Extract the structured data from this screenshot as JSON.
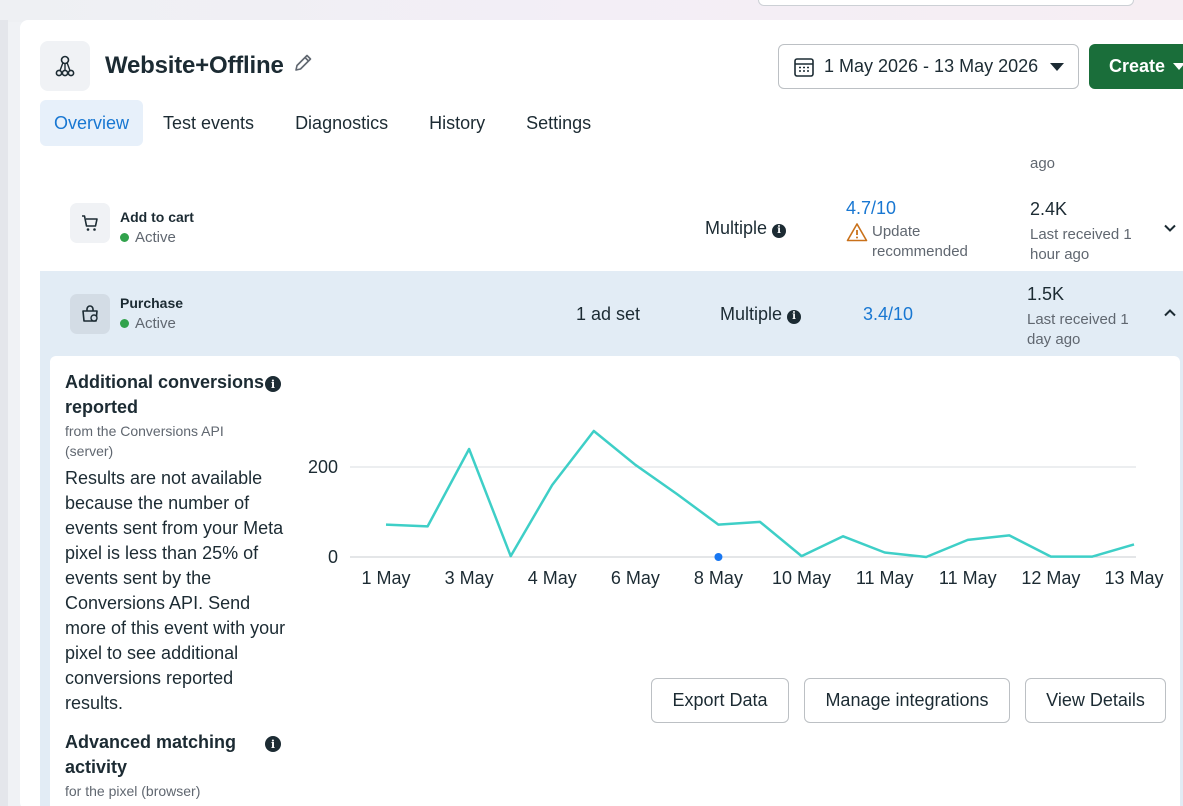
{
  "header": {
    "title": "Website+Offline",
    "date_range": "1 May 2026 - 13 May 2026",
    "create_label": "Create"
  },
  "tabs": [
    {
      "label": "Overview",
      "active": true
    },
    {
      "label": "Test events",
      "active": false
    },
    {
      "label": "Diagnostics",
      "active": false
    },
    {
      "label": "History",
      "active": false
    },
    {
      "label": "Settings",
      "active": false
    }
  ],
  "prev_row_received": "ago",
  "events": [
    {
      "name": "Add to cart",
      "status": "Active",
      "ad_sets": "",
      "integration": "Multiple",
      "score": "4.7/10",
      "score_note": "Update recommended",
      "count": "2.4K",
      "received": "Last received 1 hour ago",
      "expanded": false
    },
    {
      "name": "Purchase",
      "status": "Active",
      "ad_sets": "1 ad set",
      "integration": "Multiple",
      "score": "3.4/10",
      "score_note": "",
      "count": "1.5K",
      "received": "Last received 1 day ago",
      "expanded": true
    }
  ],
  "details": {
    "additional": {
      "title": "Additional conversions reported",
      "subtitle": "from the Conversions API (server)",
      "body": "Results are not available because the number of events sent from your Meta pixel is less than 25% of events sent by the Conversions API. Send more of this event with your pixel to see additional conversions reported results."
    },
    "advanced": {
      "title": "Advanced matching activity",
      "subtitle": "for the pixel (browser)"
    },
    "buttons": {
      "export": "Export Data",
      "manage": "Manage integrations",
      "view": "View Details"
    }
  },
  "colors": {
    "line": "#3ecfc7",
    "link": "#1877d2",
    "create": "#1a6e3a",
    "expanded_row": "#e2ecf5",
    "active_dot": "#31a24c",
    "marker": "#1877f2"
  },
  "icons": {
    "dataset": "dataset-nodes-icon",
    "edit": "pencil-icon",
    "calendar": "calendar-icon",
    "cart": "cart-icon",
    "purchase": "shopping-bag-icon",
    "warning": "warning-icon",
    "info": "info-icon"
  },
  "chart_data": {
    "type": "line",
    "x": [
      "1 May",
      "2 May",
      "3 May",
      "4 May",
      "4 May",
      "5 May",
      "6 May",
      "7 May",
      "8 May",
      "9 May",
      "10 May",
      "10 May",
      "11 May",
      "11 May",
      "11 May",
      "12 May",
      "12 May",
      "13 May",
      "13 May"
    ],
    "tick_labels": [
      "1 May",
      "3 May",
      "4 May",
      "6 May",
      "8 May",
      "10 May",
      "11 May",
      "11 May",
      "12 May",
      "13 May"
    ],
    "series": [
      {
        "values": [
          72,
          68,
          240,
          2,
          160,
          280,
          205,
          140,
          72,
          78,
          2,
          46,
          10,
          0,
          38,
          48,
          1,
          1,
          28
        ]
      }
    ],
    "ylim": [
      0,
      300
    ],
    "yticks": [
      0,
      200
    ],
    "grid": true,
    "marker_x_index": 8,
    "marker_value": 0
  }
}
